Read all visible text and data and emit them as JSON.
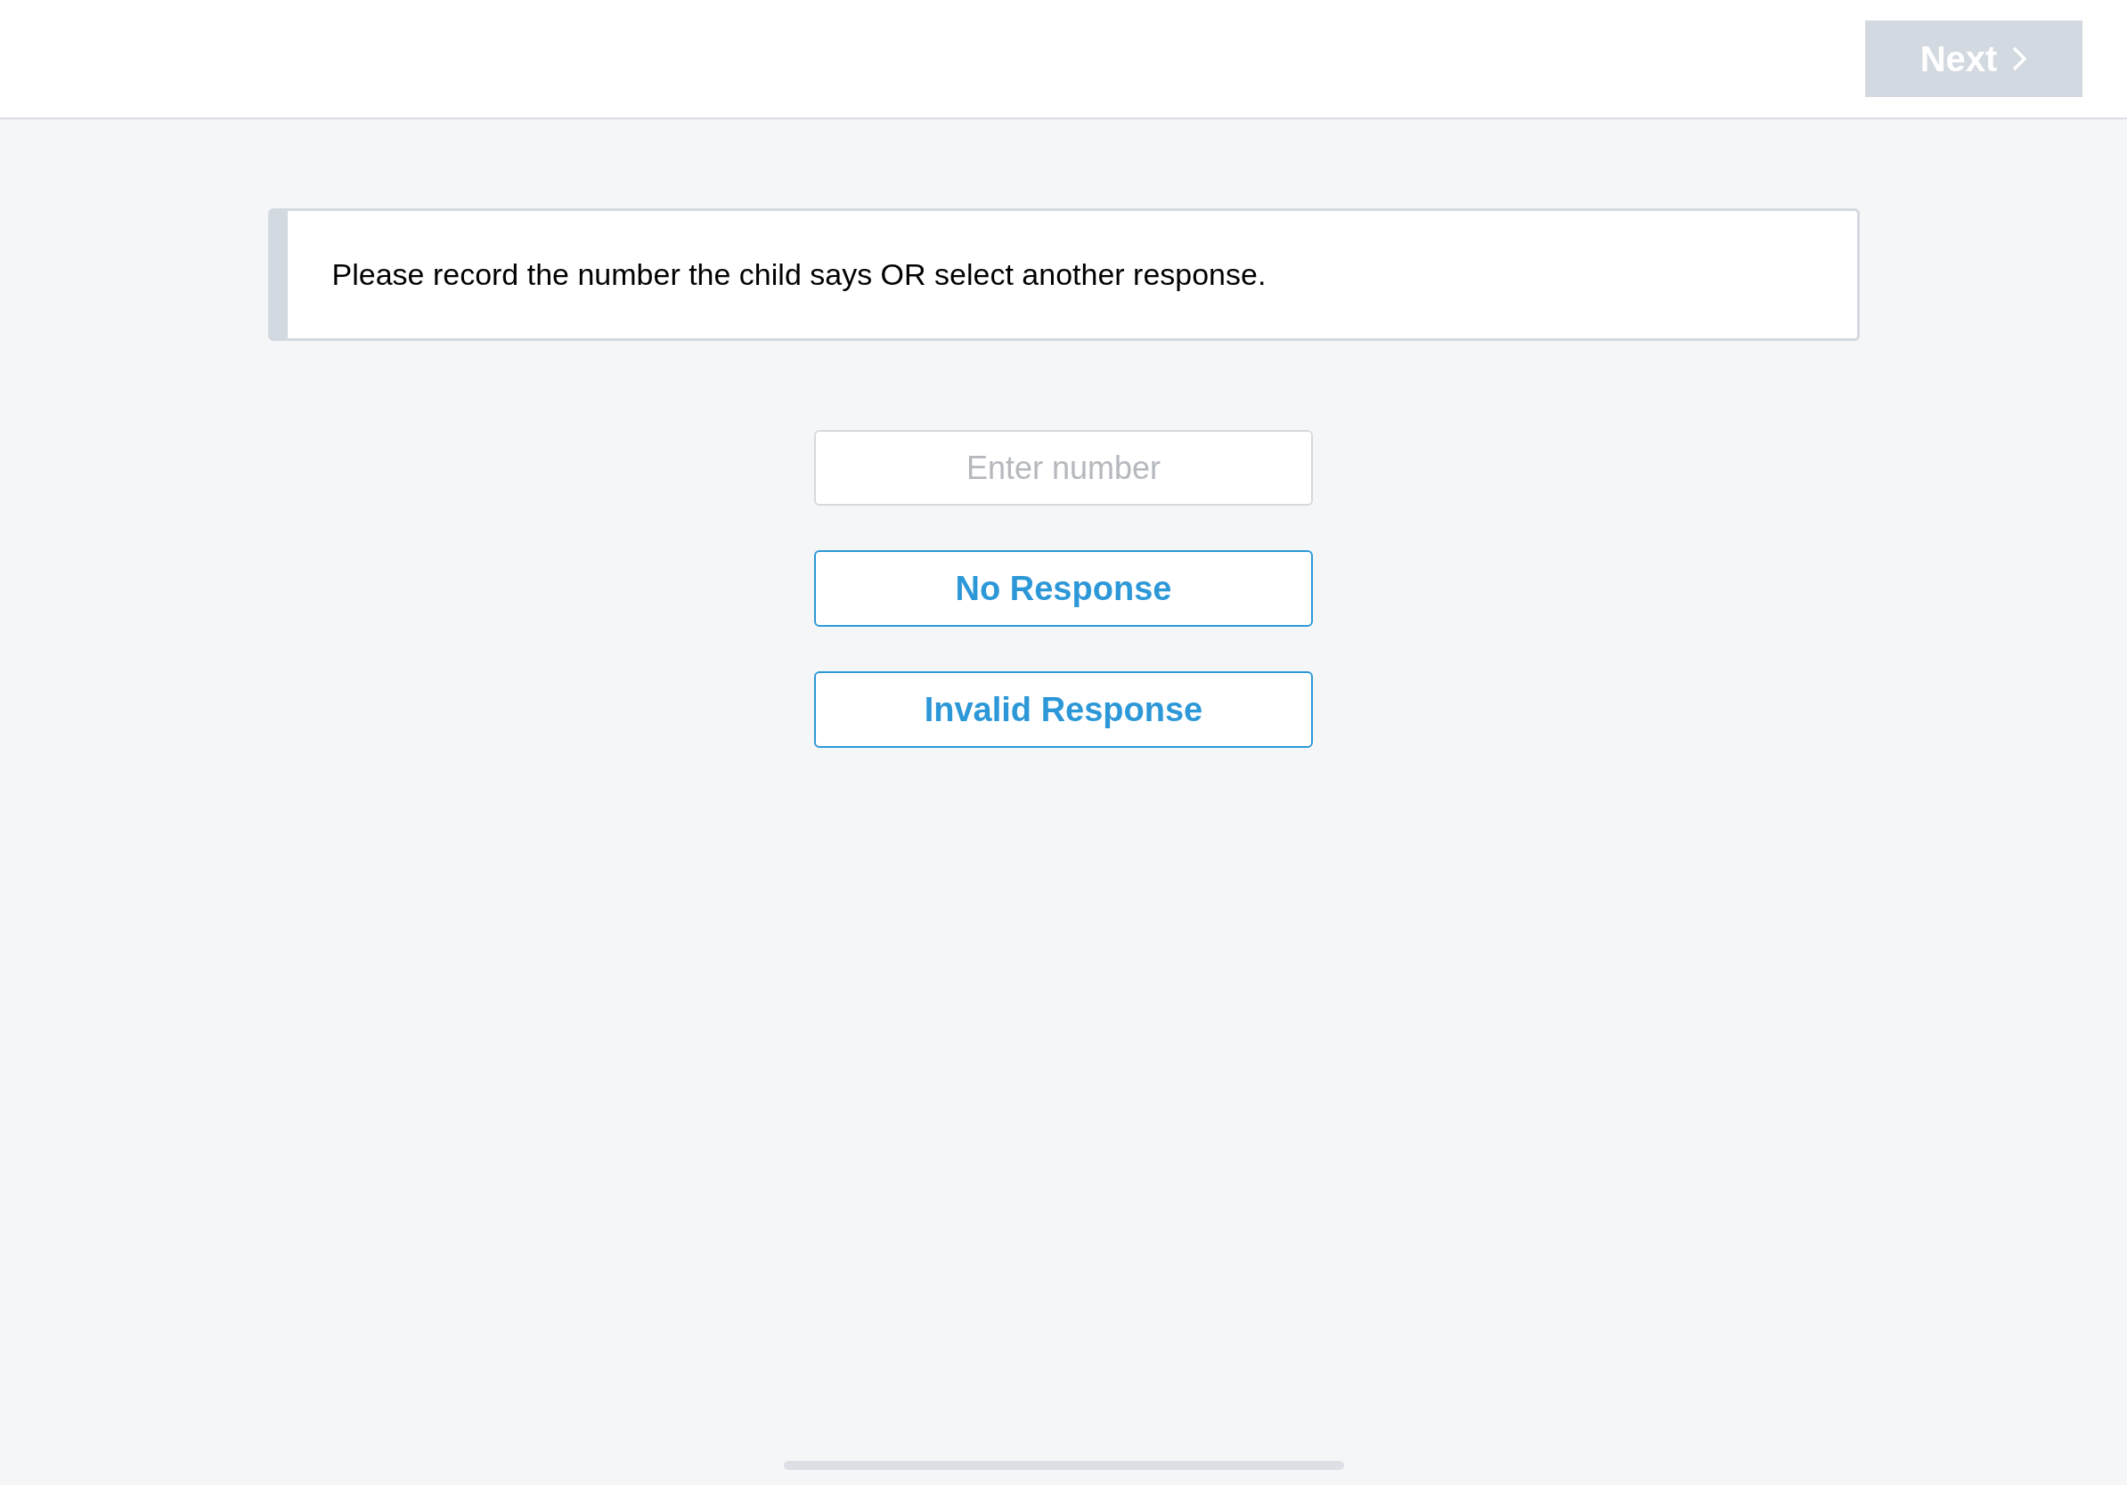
{
  "header": {
    "next_button": {
      "label": "Next",
      "disabled": true
    }
  },
  "instruction": "Please record the number the child says OR select another response.",
  "number_field": {
    "placeholder": "Enter number"
  },
  "responses": [
    {
      "label": "No Response"
    },
    {
      "label": "Invalid Response"
    }
  ]
}
